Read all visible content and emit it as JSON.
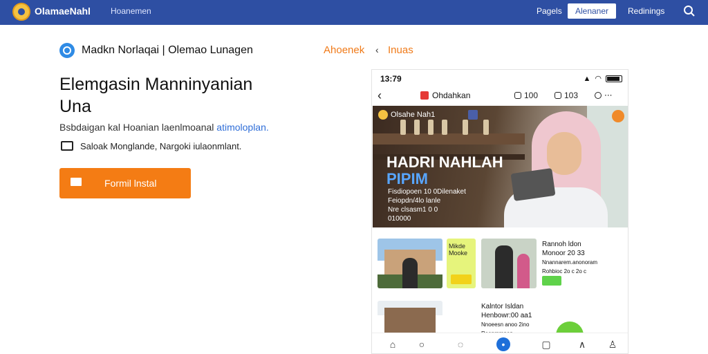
{
  "header": {
    "app_title": "OlamaeNahl",
    "nav_link": "Hoanemen",
    "pages_link": "Pagels",
    "top_button": "Alenaner",
    "login_link": "Redinings"
  },
  "intro": {
    "breadcrumb": "Madkn Norlaqai | Olemao Lunagen",
    "nav_a": "Ahoenek",
    "nav_sep": "‹",
    "nav_b": "Inuas",
    "headline": "Elemgasin Manninyanian Una",
    "subline": "Bsbdaigan kal Hoanian laenlmoanal",
    "subline_link": "atimoloplan.",
    "note": "Saloak Monglande, Nargoki iulaonmlant."
  },
  "install_button": {
    "label": "Formil lnstal"
  },
  "phone": {
    "time": "13:79",
    "channel": "Ohdahkan",
    "stat1": "100",
    "stat2": "103",
    "hero": {
      "badge": "Olsahe Nah1",
      "title_line1": "HADRI NAHLAH",
      "title_line2": "PIPIM",
      "line1": "Fisdiopoen 10 0Dilenaket",
      "line2": "Feiopdn/4lo lanle",
      "line3": "Nre clsasm1 0 0",
      "line4": "010000"
    },
    "card1": {
      "yellow_label": "Mikde Mooke",
      "meta1": "Rannoh ldon",
      "meta2": "Monoor 20 33",
      "meta3": "Nnannarem.anonoram",
      "meta4": "Rohbioc 2o c 2o c"
    },
    "card2": {
      "meta1": "Kalntor Isldan",
      "meta2": "Henbowr:00 aa1",
      "meta3": "Nnoeesn anoo 2ino",
      "meta4": "Reanmmnon"
    }
  }
}
